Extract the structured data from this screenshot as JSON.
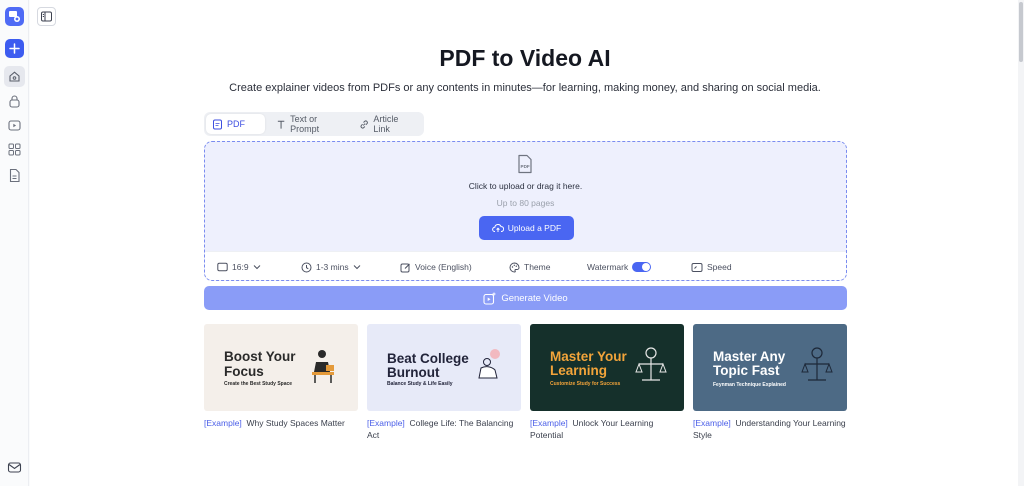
{
  "page": {
    "title": "PDF to Video AI",
    "subtitle": "Create explainer videos from PDFs or any contents in minutes—for learning, making money, and sharing on social media."
  },
  "sidebar": {
    "icons": [
      "logo-icon",
      "plus-icon",
      "home-icon",
      "lock-icon",
      "video-icon",
      "grid-icon",
      "document-icon",
      "mail-icon"
    ]
  },
  "tabs": [
    {
      "label": "PDF",
      "icon": "pdf-icon",
      "active": true
    },
    {
      "label": "Text or Prompt",
      "icon": "text-icon",
      "active": false
    },
    {
      "label": "Article Link",
      "icon": "link-icon",
      "active": false
    }
  ],
  "upload": {
    "instruction": "Click to upload or drag it here.",
    "limit": "Up to 80 pages",
    "button_label": "Upload a PDF"
  },
  "options": {
    "ratio": "16:9",
    "duration": "1-3 mins",
    "voice": "Voice (English)",
    "theme": "Theme",
    "watermark": "Watermark",
    "watermark_on": true,
    "speed": "Speed"
  },
  "generate_label": "Generate Video",
  "examples": {
    "tag": "[Example]",
    "items": [
      {
        "thumb_title_1": "Boost Your",
        "thumb_title_2": "Focus",
        "thumb_sub": "Create the Best Study Space",
        "caption": "Why Study Spaces Matter",
        "bg": "#f4efea",
        "title_color": "#2a2a2a"
      },
      {
        "thumb_title_1": "Beat College",
        "thumb_title_2": "Burnout",
        "thumb_sub": "Balance Study & Life Easily",
        "caption": "College Life: The Balancing Act",
        "bg": "#e7eaf8",
        "title_color": "#22243a"
      },
      {
        "thumb_title_1": "Master Your",
        "thumb_title_2": "Learning",
        "thumb_sub": "Customize Study for Success",
        "caption": "Unlock Your Learning Potential",
        "bg": "#15302b",
        "title_color": "#f3a43a"
      },
      {
        "thumb_title_1": "Master Any",
        "thumb_title_2": "Topic Fast",
        "thumb_sub": "Feynman Technique Explained",
        "caption": "Understanding Your Learning Style",
        "bg": "#4d6a85",
        "title_color": "#ffffff"
      }
    ]
  },
  "colors": {
    "accent": "#4a66f2",
    "generate": "#8a9cf7",
    "upload_bg": "#eef0fd"
  }
}
